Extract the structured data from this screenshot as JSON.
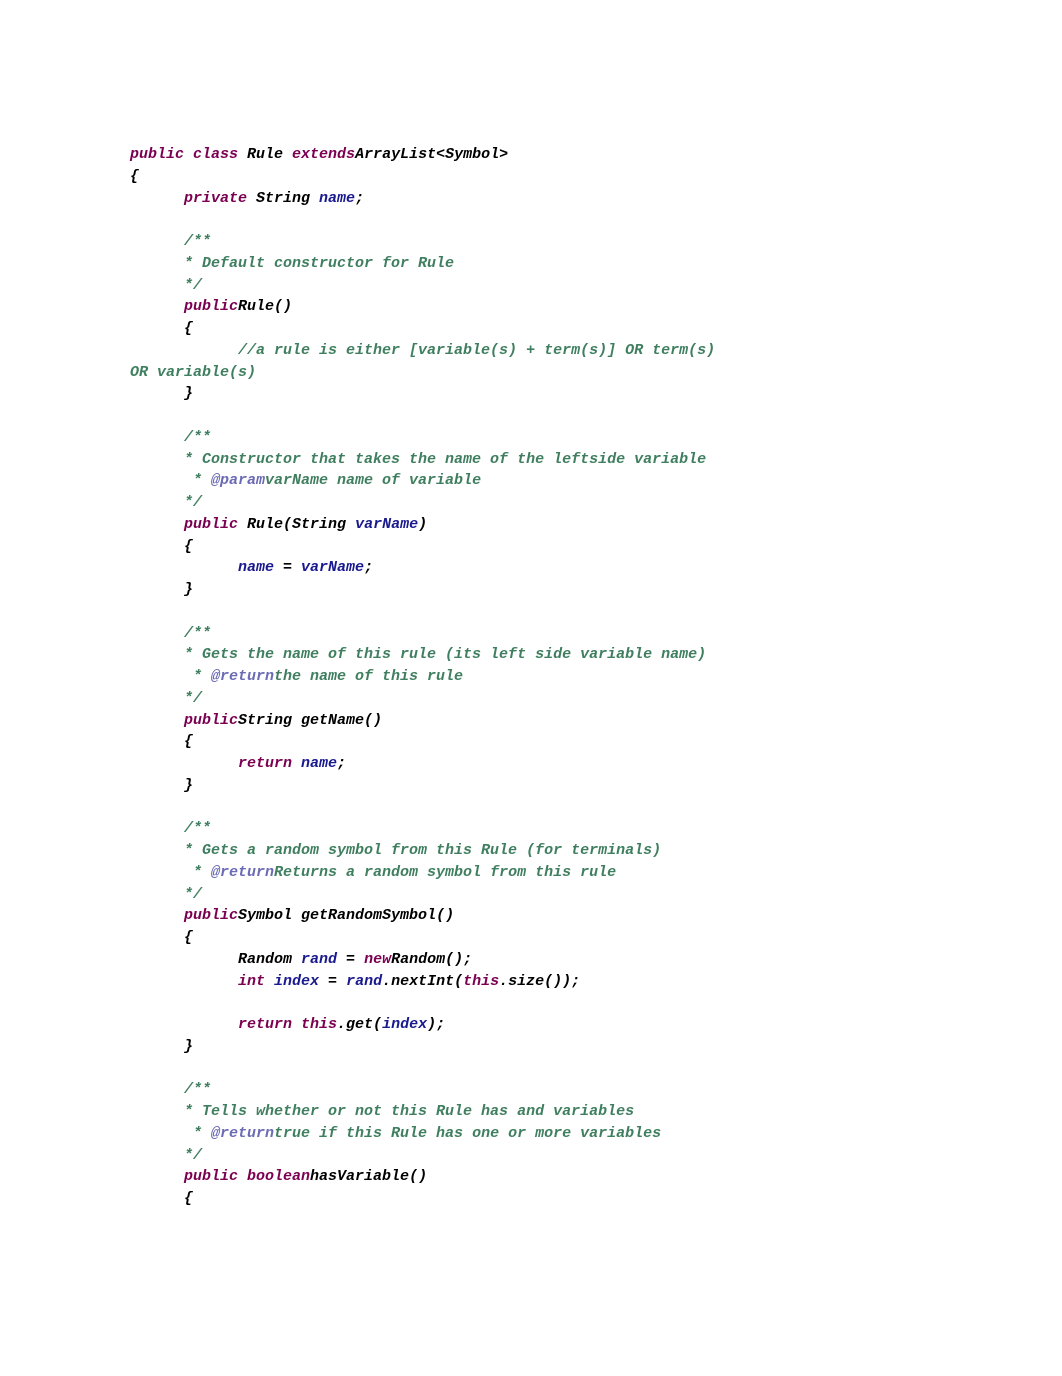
{
  "lines": {
    "l01a": "public",
    "l01b": " class ",
    "l01c": "Rule ",
    "l01d": "extends",
    "l01e": "ArrayList<Symbol>",
    "l02": "{",
    "l03a": "      private ",
    "l03b": "String ",
    "l03c": "name",
    "l03d": ";",
    "l04": "",
    "l05": "      /**",
    "l06": "      * Default constructor for Rule",
    "l07": "      */",
    "l08a": "      public",
    "l08b": "Rule()",
    "l09": "      {",
    "l10": "            //a rule is either [variable(s) + term(s)] OR term(s)",
    "l10b": "OR variable(s)",
    "l11": "      }",
    "l12": "",
    "l13": "      /**",
    "l14": "      * Constructor that takes the name of the leftside variable",
    "l15a": "       * ",
    "l15b": "@param",
    "l15c": "varName name of variable",
    "l16": "      */",
    "l17a": "      public ",
    "l17b": "Rule(String ",
    "l17c": "varName",
    "l17d": ")",
    "l18": "      {",
    "l19a": "            name ",
    "l19b": "= ",
    "l19c": "varName",
    "l19d": ";",
    "l20": "      }",
    "l21": "",
    "l22": "      /**",
    "l23": "      * Gets the name of this rule (its left side variable name)",
    "l24a": "       * ",
    "l24b": "@return",
    "l24c": "the name of this rule",
    "l25": "      */",
    "l26a": "      public",
    "l26b": "String getName()",
    "l27": "      {",
    "l28a": "            return ",
    "l28b": "name",
    "l28c": ";",
    "l29": "      }",
    "l30": "",
    "l31": "      /**",
    "l32": "      * Gets a random symbol from this Rule (for terminals)",
    "l33a": "       * ",
    "l33b": "@return",
    "l33c": "Returns a random symbol from this rule",
    "l34": "      */",
    "l35a": "      public",
    "l35b": "Symbol getRandomSymbol()",
    "l36": "      {",
    "l37a": "            Random ",
    "l37b": "rand ",
    "l37c": "= ",
    "l37d": "new",
    "l37e": "Random();",
    "l38a": "            int ",
    "l38b": "index ",
    "l38c": "= ",
    "l38d": "rand",
    "l38e": ".nextInt(",
    "l38f": "this",
    "l38g": ".size());",
    "l39": "",
    "l40a": "            return ",
    "l40b": "this",
    "l40c": ".get(",
    "l40d": "index",
    "l40e": ");",
    "l41": "      }",
    "l42": "",
    "l43": "      /**",
    "l44": "      * Tells whether or not this Rule has and variables",
    "l45a": "       * ",
    "l45b": "@return",
    "l45c": "true if this Rule has one or more variables",
    "l46": "      */",
    "l47a": "      public ",
    "l47b": "boolean",
    "l47c": "hasVariable()",
    "l48": "      {"
  }
}
